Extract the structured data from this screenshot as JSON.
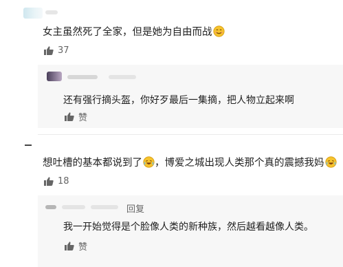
{
  "colors": {
    "text": "#1f1f1f",
    "muted": "#666666",
    "reply_bg": "#f7f7f7",
    "emoji_face": "#f6c32d"
  },
  "comments": [
    {
      "text": "女主虽然死了全家，但是她为自由而战",
      "emoji": "smile-emoji",
      "likes": "37"
    },
    {
      "text": "还有强行摘头盔，你好歹最后一集摘，把人物立起来啊",
      "likes": "赞",
      "is_reply": true
    },
    {
      "text": "想吐槽的基本都说到了",
      "text2": "，博爱之城出现人类那个真的震撼我妈",
      "emoji": "laugh-cry-emoji",
      "likes": "18"
    },
    {
      "reply_label": "回复",
      "text": "我一开始觉得是个脸像人类的新种族，然后越看越像人类。",
      "likes": "赞",
      "is_reply": true
    }
  ]
}
